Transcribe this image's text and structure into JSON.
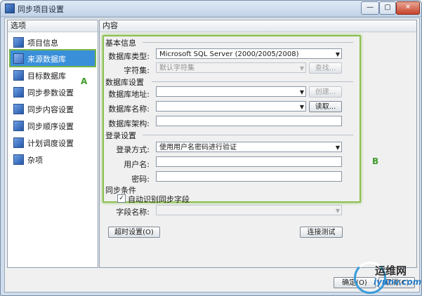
{
  "window": {
    "title": "同步项目设置"
  },
  "title_buttons": {
    "minimize": "—",
    "maximize": "▢",
    "close": "✕"
  },
  "left_panel": {
    "header": "选项",
    "items": [
      {
        "label": "项目信息"
      },
      {
        "label": "来源数据库"
      },
      {
        "label": "目标数据库"
      },
      {
        "label": "同步参数设置"
      },
      {
        "label": "同步内容设置"
      },
      {
        "label": "同步顺序设置"
      },
      {
        "label": "计划调度设置"
      },
      {
        "label": "杂项"
      }
    ]
  },
  "right_panel": {
    "header": "内容",
    "basic": {
      "title": "基本信息",
      "db_type_label": "数据库类型:",
      "db_type_value": "Microsoft SQL Server (2000/2005/2008)",
      "charset_label": "字符集:",
      "charset_value": "默认字符集",
      "find_button": "查找..."
    },
    "db_settings": {
      "title": "数据库设置",
      "address_label": "数据库地址:",
      "create_button": "创建...",
      "name_label": "数据库名称:",
      "read_button": "读取...",
      "schema_label": "数据库架构:"
    },
    "login": {
      "title": "登录设置",
      "method_label": "登录方式:",
      "method_value": "使用用户名密码进行验证",
      "username_label": "用户名:",
      "password_label": "密码:"
    },
    "sync": {
      "title": "同步条件",
      "auto_detect_label": "自动识别同步字段",
      "auto_detect_checked": true,
      "field_name_label": "字段名称:"
    },
    "timeout_button": "超时设置(O)",
    "test_button": "连接测试"
  },
  "footer": {
    "ok_button": "确定(O)",
    "cancel_button": "取消(C)"
  },
  "annotations": {
    "a": "A",
    "b": "B"
  },
  "watermark": {
    "title": "运维网",
    "url": "iyunv.com"
  },
  "colors": {
    "accent": "#3a8fd9",
    "highlight": "#8cc152"
  }
}
